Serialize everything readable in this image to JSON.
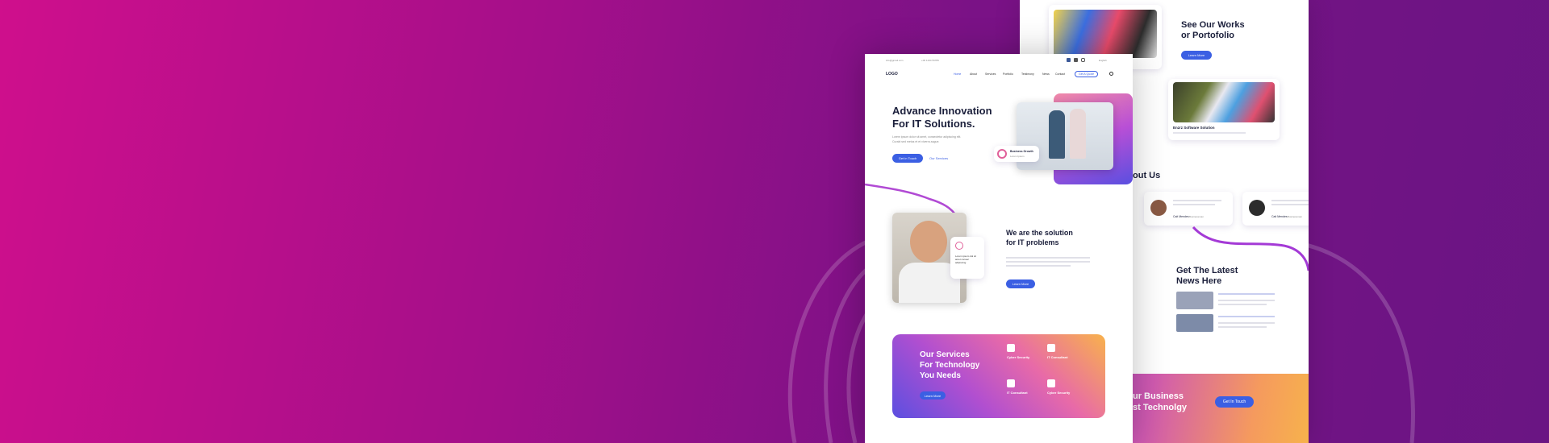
{
  "colors": {
    "accent": "#3b5fe3",
    "bg_start": "#cf0f8c",
    "bg_end": "#6a1583"
  },
  "back": {
    "portfolio_title_1": "See Our Works",
    "portfolio_title_2": "or Portofolio",
    "portfolio_btn": "Learn More",
    "project_name": "Enzrz Software Solution",
    "about_title": "out Us",
    "review_1_name": "Cait Mendes",
    "review_1_role": "Businessman",
    "review_2_name": "Cait Mendes",
    "review_2_role": "Businessman",
    "news_title_1": "Get The Latest",
    "news_title_2": "News Here",
    "cta_title_1": "ur Business",
    "cta_title_2": "st Technolgy",
    "cta_btn": "Get In Touch"
  },
  "front": {
    "email": "info@gmail.com",
    "phone": "+00 1234 56789",
    "lang": "English",
    "logo": "LOGO",
    "nav": [
      "Home",
      "About",
      "Services",
      "Portfolio",
      "Testimony",
      "News",
      "Contact"
    ],
    "quote_btn": "Get A Quote",
    "hero_title_1": "Advance Innovation",
    "hero_title_2": "For IT Solutions.",
    "hero_desc_1": "Lorem ipsum dolor sit amet, consectetur adipiscing elit.",
    "hero_desc_2": "Curabi sed metus et et viverra augue.",
    "hero_btn_1": "Get in Touch",
    "hero_btn_2": "Our Services",
    "badge_title": "Business Growth",
    "badge_sub": "Lorem Ipsum",
    "sol_title_1": "We are the solution",
    "sol_title_2": "for IT problems",
    "sol_card": "Lorem ipsum dol sit amet consec adipiscing",
    "sol_btn": "Learn More",
    "svc_title_1": "Our Services",
    "svc_title_2": "For Technology",
    "svc_title_3": "You Needs",
    "svc_btn": "Learn More",
    "svc_items": [
      "Cyber Security",
      "IT Consultant",
      "IT Consultant",
      "Cyber Security"
    ]
  }
}
